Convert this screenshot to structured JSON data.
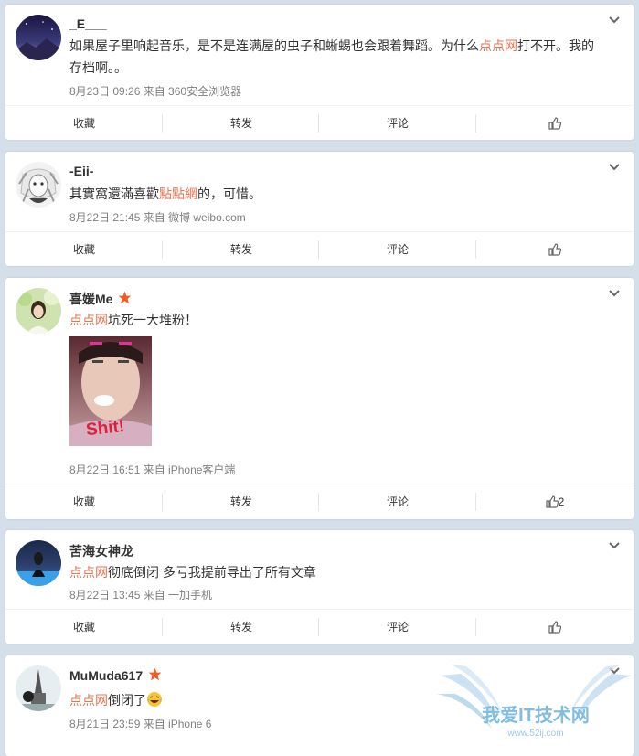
{
  "posts": [
    {
      "username": "_E___",
      "content": [
        {
          "text": "如果屋子里响起音乐，是不是连满屋的虫子和蜥蜴也会跟着舞蹈。为什么",
          "link": false
        },
        {
          "text": "点点网",
          "link": true
        },
        {
          "text": "打不开。我的存档啊。。",
          "link": false
        }
      ],
      "meta": "8月23日 09:26 来自 360安全浏览器",
      "actions": {
        "collect": "收藏",
        "repost": "转发",
        "comment": "评论",
        "like": ""
      }
    },
    {
      "username": "-Eii-",
      "content": [
        {
          "text": "其實窩還滿喜歡",
          "link": false
        },
        {
          "text": "點點網",
          "link": true
        },
        {
          "text": "的，可惜。",
          "link": false
        }
      ],
      "meta": "8月22日 21:45 来自 微博 weibo.com",
      "actions": {
        "collect": "收藏",
        "repost": "转发",
        "comment": "评论",
        "like": ""
      }
    },
    {
      "username": "喜媛Me",
      "verified": true,
      "content": [
        {
          "text": "点点网",
          "link": true
        },
        {
          "text": "坑死一大堆粉！",
          "link": false
        }
      ],
      "image_text": "Shit!",
      "meta": "8月22日 16:51 来自 iPhone客户端",
      "actions": {
        "collect": "收藏",
        "repost": "转发",
        "comment": "评论",
        "like": "2"
      }
    },
    {
      "username": "苦海女神龙",
      "content": [
        {
          "text": "点点网",
          "link": true
        },
        {
          "text": "彻底倒闭 多亏我提前导出了所有文章",
          "link": false
        }
      ],
      "meta": "8月22日 13:45 来自 一加手机",
      "actions": {
        "collect": "收藏",
        "repost": "转发",
        "comment": "评论",
        "like": ""
      }
    },
    {
      "username": "MuMuda617",
      "verified": true,
      "content": [
        {
          "text": "点点网",
          "link": true
        },
        {
          "text": "倒闭了",
          "link": false
        }
      ],
      "emoji": "laughing-crying-emoji",
      "meta": "8月21日 23:59 来自 iPhone 6"
    }
  ],
  "watermark": {
    "text": "我爱IT技术网",
    "url": "www.52ij.com"
  },
  "colors": {
    "link": "#eb7350",
    "verified_star": "#f55a23",
    "background": "#d5dfea"
  },
  "icons": {
    "menu": "chevron-down-icon",
    "like": "thumbs-up-icon",
    "verified": "star-icon"
  }
}
